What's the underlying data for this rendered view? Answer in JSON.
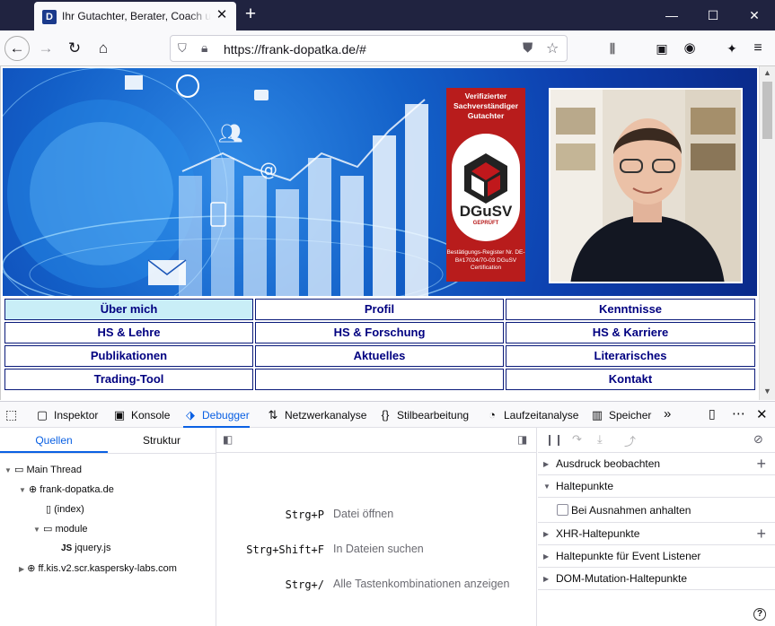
{
  "browser": {
    "tab_title": "Ihr Gutachter, Berater, Coach und",
    "url": "https://frank-dopatka.de/#"
  },
  "seal": {
    "heading": "Verifizierter Sachverständiger Gutachter",
    "brand": "DGuSV",
    "brand_sub": "GEPRÜFT",
    "footer": "Bestätigungs-Register Nr. DE-B#17024/70-03 DGuSV Certification"
  },
  "menu": [
    {
      "label": "Über mich",
      "active": true
    },
    {
      "label": "Profil"
    },
    {
      "label": "Kenntnisse"
    },
    {
      "label": "HS & Lehre"
    },
    {
      "label": "HS & Forschung"
    },
    {
      "label": "HS & Karriere"
    },
    {
      "label": "Publikationen"
    },
    {
      "label": "Aktuelles"
    },
    {
      "label": "Literarisches"
    },
    {
      "label": "Trading-Tool"
    },
    {
      "label": ""
    },
    {
      "label": "Kontakt"
    }
  ],
  "devtools": {
    "tabs": [
      {
        "label": "Inspektor",
        "icon": "inspector-icon"
      },
      {
        "label": "Konsole",
        "icon": "console-icon"
      },
      {
        "label": "Debugger",
        "icon": "debugger-icon",
        "selected": true
      },
      {
        "label": "Netzwerkanalyse",
        "icon": "network-icon"
      },
      {
        "label": "Stilbearbeitung",
        "icon": "style-editor-icon"
      },
      {
        "label": "Laufzeitanalyse",
        "icon": "performance-icon"
      },
      {
        "label": "Speicher",
        "icon": "memory-icon"
      }
    ],
    "sources": {
      "tab_sources": "Quellen",
      "tab_outline": "Struktur",
      "tree": [
        {
          "label": "Main Thread",
          "level": 0,
          "icon": "window-icon",
          "expanded": true
        },
        {
          "label": "frank-dopatka.de",
          "level": 1,
          "icon": "globe-icon",
          "expanded": true
        },
        {
          "label": "(index)",
          "level": 2,
          "icon": "file-icon"
        },
        {
          "label": "module",
          "level": 2,
          "icon": "folder-icon",
          "expanded": true
        },
        {
          "label": "jquery.js",
          "level": 3,
          "icon": "js-icon"
        },
        {
          "label": "ff.kis.v2.scr.kaspersky-labs.com",
          "level": 1,
          "icon": "globe-icon",
          "expanded": false
        }
      ]
    },
    "shortcuts": [
      {
        "key": "Strg+P",
        "label": "Datei öffnen"
      },
      {
        "key": "Strg+Shift+F",
        "label": "In Dateien suchen"
      },
      {
        "key": "Strg+/",
        "label": "Alle Tastenkombinationen anzeigen"
      }
    ],
    "right_panel": {
      "watch": "Ausdruck beobachten",
      "breakpoints": "Haltepunkte",
      "pause_exceptions": "Bei Ausnahmen anhalten",
      "xhr": "XHR-Haltepunkte",
      "event_listener": "Haltepunkte für Event Listener",
      "dom_mutation": "DOM-Mutation-Haltepunkte"
    }
  }
}
